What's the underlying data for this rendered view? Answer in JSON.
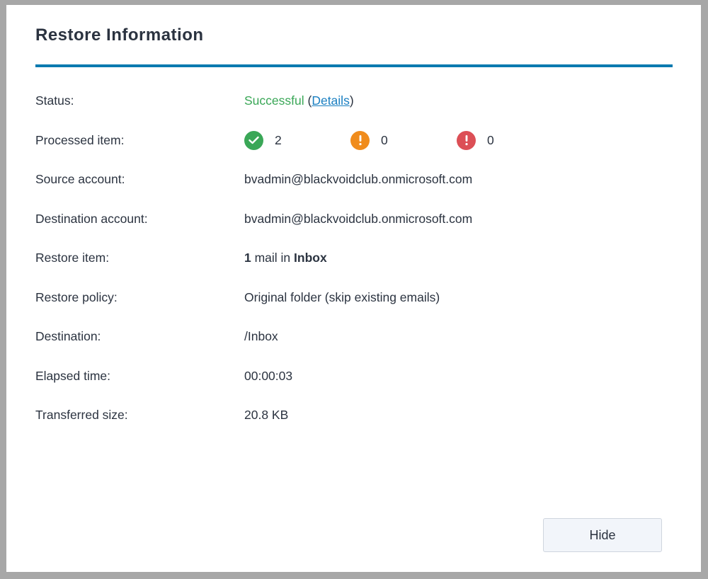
{
  "dialog": {
    "title": "Restore Information",
    "accent_color": "#0a7ab0"
  },
  "status": {
    "label": "Status:",
    "value": "Successful",
    "value_color": "#3aa757",
    "open_paren": "(",
    "details_link": "Details",
    "close_paren": ")"
  },
  "processed": {
    "label": "Processed item:",
    "success": {
      "icon": "check-circle-icon",
      "color": "#3aa757",
      "count": "2"
    },
    "warning": {
      "icon": "warning-circle-icon",
      "color": "#f08c1c",
      "count": "0"
    },
    "error": {
      "icon": "error-circle-icon",
      "color": "#dc4f56",
      "count": "0"
    }
  },
  "source_account": {
    "label": "Source account:",
    "value": "bvadmin@blackvoidclub.onmicrosoft.com"
  },
  "destination_account": {
    "label": "Destination account:",
    "value": "bvadmin@blackvoidclub.onmicrosoft.com"
  },
  "restore_item": {
    "label": "Restore item:",
    "count": "1",
    "middle_text": " mail in ",
    "folder": "Inbox"
  },
  "restore_policy": {
    "label": "Restore policy:",
    "value": "Original folder (skip existing emails)"
  },
  "destination": {
    "label": "Destination:",
    "value": "/Inbox"
  },
  "elapsed_time": {
    "label": "Elapsed time:",
    "value": "00:00:03"
  },
  "transferred_size": {
    "label": "Transferred size:",
    "value": "20.8 KB"
  },
  "footer": {
    "hide_label": "Hide"
  }
}
